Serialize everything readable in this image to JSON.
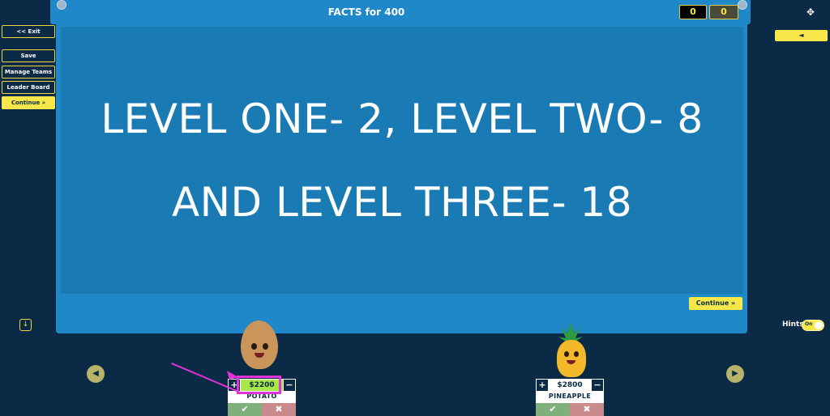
{
  "header": {
    "title": "FACTS for 400",
    "score_left": "0",
    "score_right": "0"
  },
  "sidebar": {
    "exit_label": "<< Exit",
    "a_tag": "A",
    "save_label": "Save",
    "manage_teams_label": "Manage Teams",
    "leader_board_label": "Leader Board",
    "continue_label": "Continue »"
  },
  "question": {
    "line1": "LEVEL ONE- 2, LEVEL TWO- 8",
    "line2": "AND LEVEL THREE- 18"
  },
  "board": {
    "continue_label": "Continue »"
  },
  "right": {
    "back_label": "◄",
    "hints_label": "Hints",
    "hints_toggle": "On"
  },
  "teams": [
    {
      "name": "POTATO",
      "amount": "$2200",
      "plus": "+",
      "minus": "−",
      "correct": "✔",
      "wrong": "✖"
    },
    {
      "name": "PINEAPPLE",
      "amount": "$2800",
      "plus": "+",
      "minus": "−",
      "correct": "✔",
      "wrong": "✖"
    }
  ],
  "icons": {
    "fullscreen": "fullscreen-icon",
    "down": "down-arrow-icon",
    "nav_left": "left-arrow-icon",
    "nav_right": "right-arrow-icon"
  },
  "colors": {
    "background": "#0b2a45",
    "board": "#1e88c8",
    "accent_yellow": "#f8e74a",
    "highlight_magenta": "#e033d8",
    "potato_amount_bg": "#a8e64a"
  }
}
